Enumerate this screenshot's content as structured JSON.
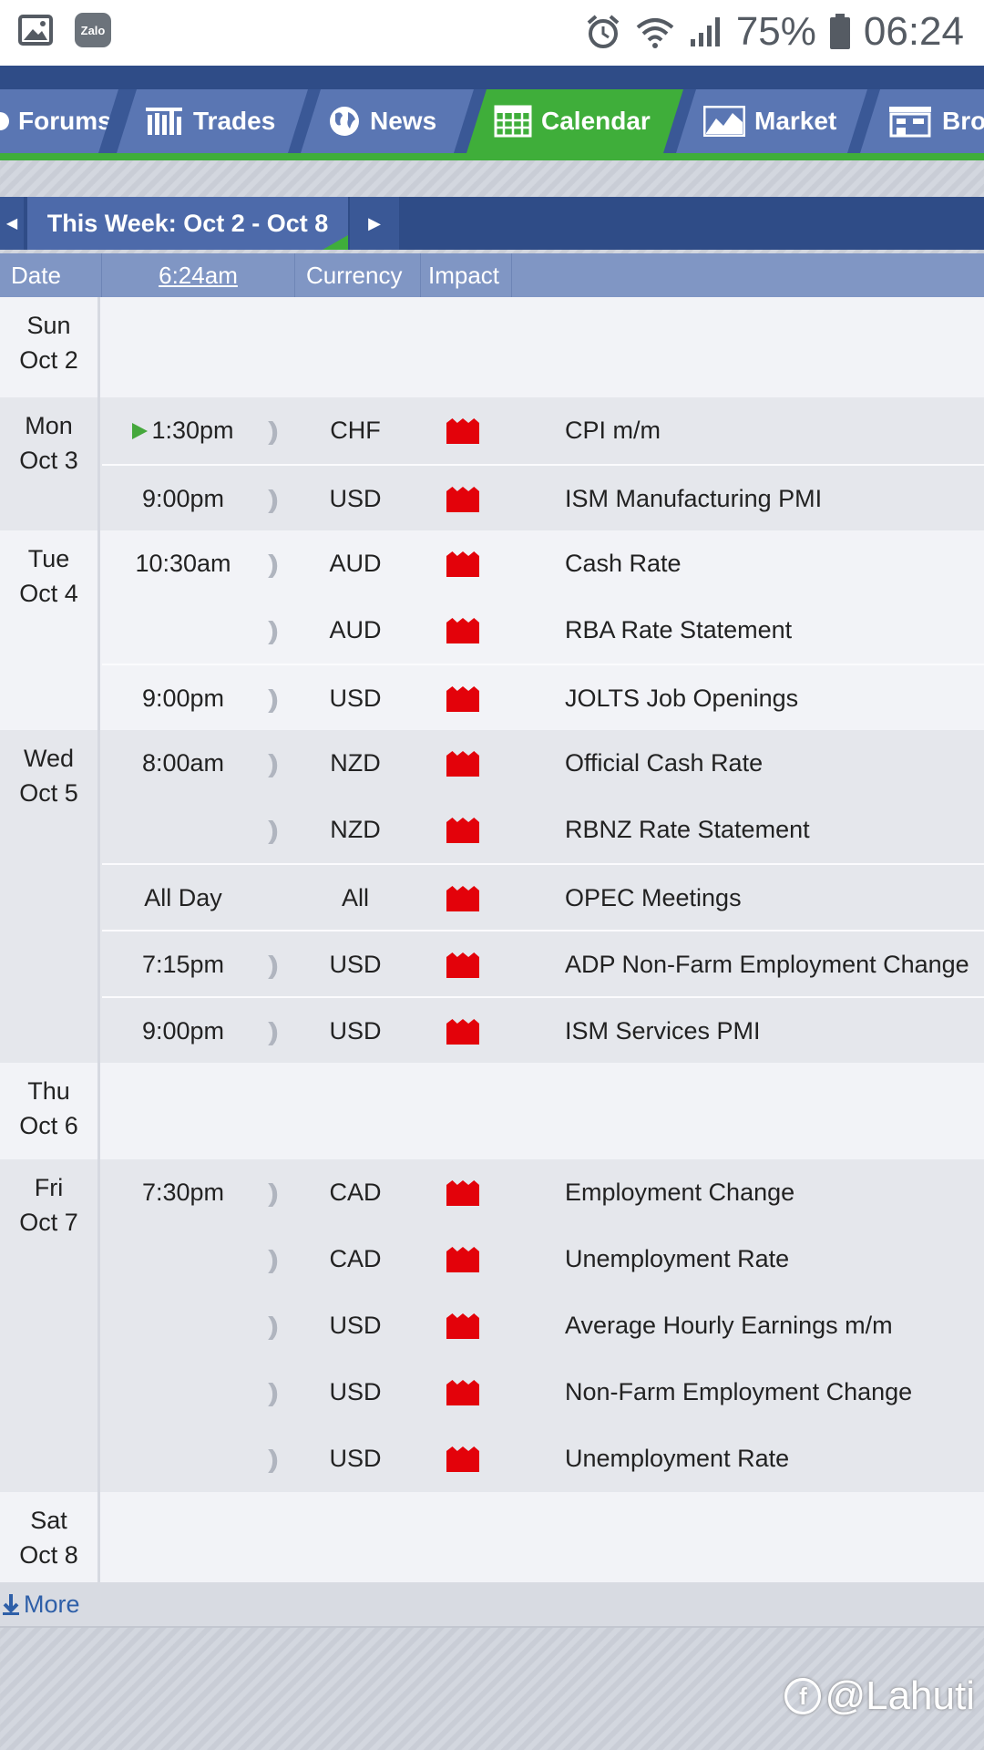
{
  "status_bar": {
    "battery": "75%",
    "time": "06:24",
    "app_badge": "Zalo"
  },
  "nav": {
    "tabs": [
      {
        "label": "Forums",
        "icon": "forum-icon"
      },
      {
        "label": "Trades",
        "icon": "bars-icon"
      },
      {
        "label": "News",
        "icon": "globe-icon"
      },
      {
        "label": "Calendar",
        "icon": "calendar-icon",
        "active": true
      },
      {
        "label": "Market",
        "icon": "chart-icon"
      },
      {
        "label": "Bro",
        "icon": "broker-icon"
      }
    ]
  },
  "week_nav": {
    "label": "This Week: Oct 2 - Oct 8"
  },
  "table_header": {
    "date": "Date",
    "time": "6:24am",
    "currency": "Currency",
    "impact": "Impact"
  },
  "days": [
    {
      "day": "Sun",
      "date": "Oct 2",
      "events": []
    },
    {
      "day": "Mon",
      "date": "Oct 3",
      "events": [
        {
          "time": "1:30pm",
          "currency": "CHF",
          "title": "CPI m/m",
          "next": true
        },
        {
          "time": "9:00pm",
          "currency": "USD",
          "title": "ISM Manufacturing PMI"
        }
      ]
    },
    {
      "day": "Tue",
      "date": "Oct 4",
      "events": [
        {
          "time": "10:30am",
          "currency": "AUD",
          "title": "Cash Rate"
        },
        {
          "time": "",
          "currency": "AUD",
          "title": "RBA Rate Statement"
        },
        {
          "time": "9:00pm",
          "currency": "USD",
          "title": "JOLTS Job Openings"
        }
      ]
    },
    {
      "day": "Wed",
      "date": "Oct 5",
      "events": [
        {
          "time": "8:00am",
          "currency": "NZD",
          "title": "Official Cash Rate"
        },
        {
          "time": "",
          "currency": "NZD",
          "title": "RBNZ Rate Statement"
        },
        {
          "time": "All Day",
          "currency": "All",
          "title": "OPEC Meetings",
          "no_sound": true
        },
        {
          "time": "7:15pm",
          "currency": "USD",
          "title": "ADP Non-Farm Employment Change"
        },
        {
          "time": "9:00pm",
          "currency": "USD",
          "title": "ISM Services PMI"
        }
      ]
    },
    {
      "day": "Thu",
      "date": "Oct 6",
      "events": []
    },
    {
      "day": "Fri",
      "date": "Oct 7",
      "events": [
        {
          "time": "7:30pm",
          "currency": "CAD",
          "title": "Employment Change"
        },
        {
          "time": "",
          "currency": "CAD",
          "title": "Unemployment Rate"
        },
        {
          "time": "",
          "currency": "USD",
          "title": "Average Hourly Earnings m/m"
        },
        {
          "time": "",
          "currency": "USD",
          "title": "Non-Farm Employment Change"
        },
        {
          "time": "",
          "currency": "USD",
          "title": "Unemployment Rate"
        }
      ]
    },
    {
      "day": "Sat",
      "date": "Oct 8",
      "events": []
    }
  ],
  "impact_color": "#e3020a",
  "more": {
    "label": "More"
  },
  "watermark": "@Lahuti"
}
